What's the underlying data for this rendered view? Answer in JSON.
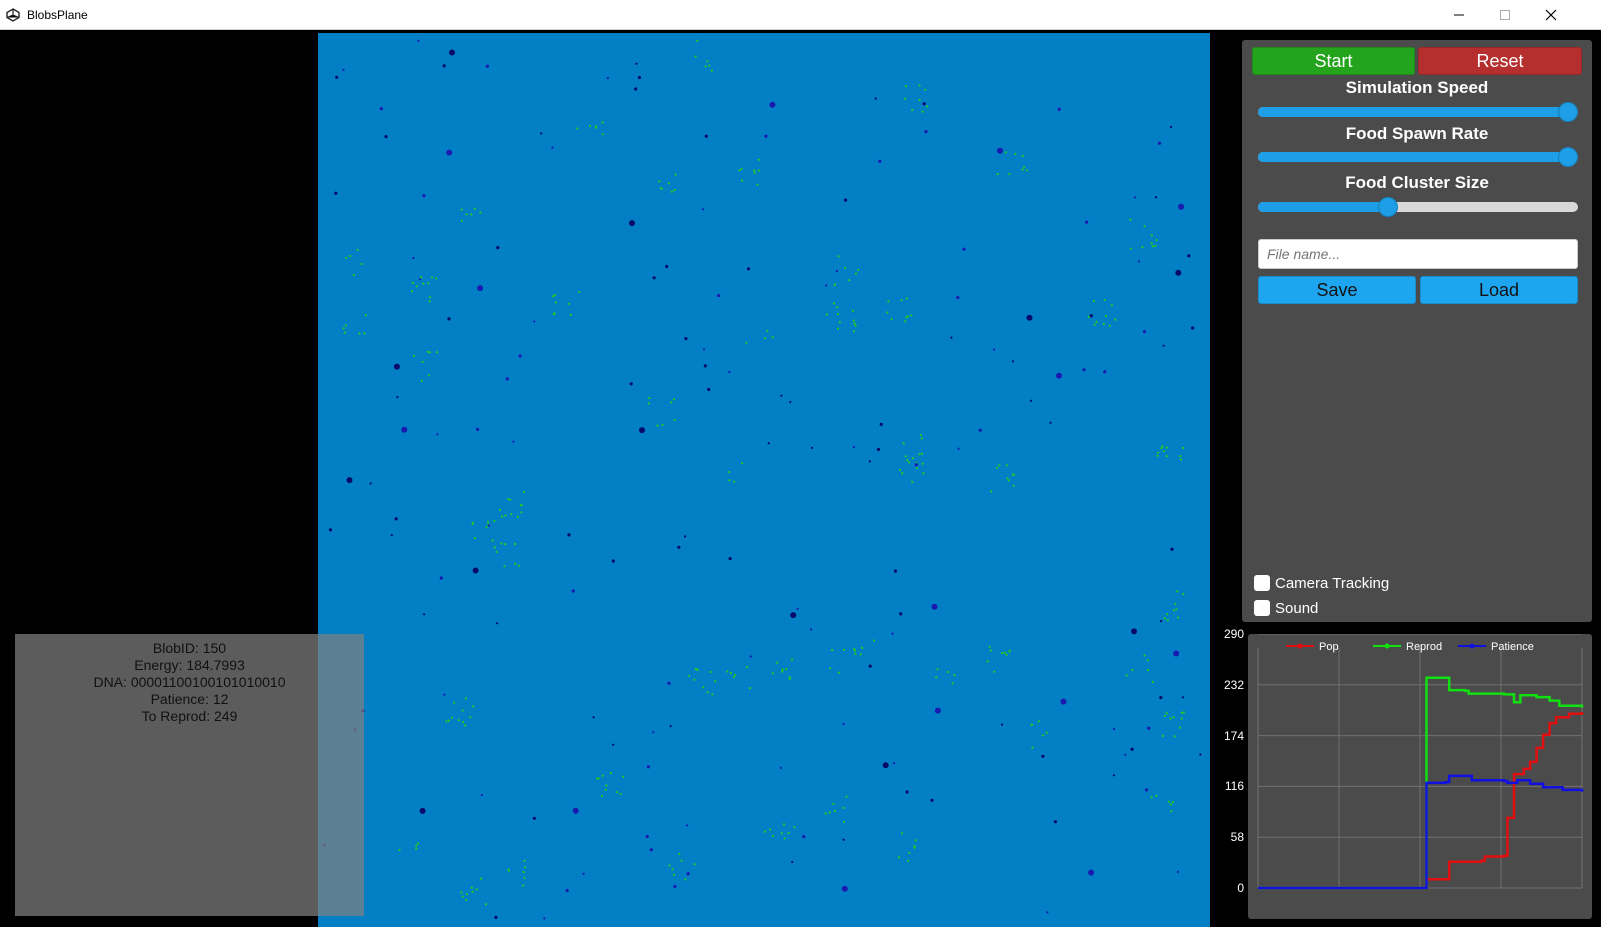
{
  "window": {
    "title": "BlobsPlane",
    "minimize_icon": "minimize-icon",
    "maximize_icon": "maximize-icon",
    "close_icon": "close-icon"
  },
  "controls": {
    "start_label": "Start",
    "reset_label": "Reset",
    "sliders": [
      {
        "label": "Simulation Speed",
        "value": 1.0
      },
      {
        "label": "Food Spawn Rate",
        "value": 1.0
      },
      {
        "label": "Food Cluster Size",
        "value": 0.4
      }
    ],
    "file_placeholder": "File name...",
    "save_label": "Save",
    "load_label": "Load",
    "camera_tracking_label": "Camera Tracking",
    "camera_tracking_checked": false,
    "sound_label": "Sound",
    "sound_checked": false
  },
  "blob_info": {
    "line1": "BlobID: 150",
    "line2": "Energy: 184.7993",
    "line3": "DNA: 00001100100101010010",
    "line4": "Patience: 12",
    "line5": "To Reprod: 249"
  },
  "colors": {
    "plane": "#0380c5",
    "food": "#22cc22",
    "blob": "#1a1ab0",
    "pop": "#e01010",
    "reprod": "#10e010",
    "patience": "#1010e0"
  },
  "chart_data": {
    "type": "line",
    "y_ticks": [
      "290",
      "232",
      "174",
      "116",
      "58",
      "0"
    ],
    "ylim": [
      0,
      290
    ],
    "xlim": [
      0,
      100
    ],
    "grid": true,
    "legend_position": "top",
    "series": [
      {
        "name": "Pop",
        "color": "#e01010",
        "points": [
          [
            0,
            0
          ],
          [
            52,
            0
          ],
          [
            52,
            10
          ],
          [
            58,
            10
          ],
          [
            59,
            30
          ],
          [
            69,
            31
          ],
          [
            70,
            36
          ],
          [
            76,
            37
          ],
          [
            77,
            80
          ],
          [
            79,
            130
          ],
          [
            82,
            136
          ],
          [
            84,
            144
          ],
          [
            86,
            160
          ],
          [
            88,
            175
          ],
          [
            90,
            188
          ],
          [
            92,
            195
          ],
          [
            96,
            199
          ],
          [
            100,
            201
          ]
        ]
      },
      {
        "name": "Reprod",
        "color": "#10e010",
        "points": [
          [
            0,
            0
          ],
          [
            52,
            0
          ],
          [
            52,
            240
          ],
          [
            58,
            240
          ],
          [
            59,
            226
          ],
          [
            64,
            225
          ],
          [
            65,
            222
          ],
          [
            76,
            221
          ],
          [
            79,
            212
          ],
          [
            81,
            220
          ],
          [
            86,
            218
          ],
          [
            90,
            214
          ],
          [
            93,
            208
          ],
          [
            100,
            206
          ]
        ]
      },
      {
        "name": "Patience",
        "color": "#1010e0",
        "points": [
          [
            0,
            0
          ],
          [
            52,
            0
          ],
          [
            52,
            120
          ],
          [
            58,
            121
          ],
          [
            59,
            128
          ],
          [
            64,
            128
          ],
          [
            66,
            123
          ],
          [
            76,
            122
          ],
          [
            77,
            120
          ],
          [
            80,
            123
          ],
          [
            84,
            119
          ],
          [
            88,
            115
          ],
          [
            94,
            112
          ],
          [
            100,
            110
          ]
        ]
      }
    ]
  }
}
